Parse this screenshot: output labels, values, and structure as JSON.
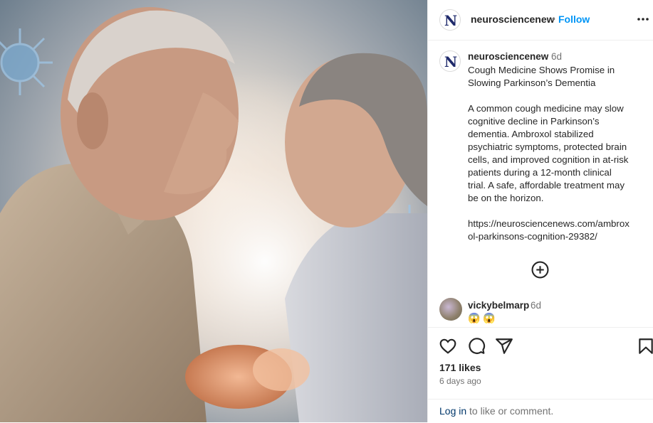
{
  "post": {
    "author": "neurosciencenew",
    "dot": "•",
    "follow_label": "Follow",
    "more_icon": "more-horizontal-icon",
    "caption": {
      "author": "neurosciencenew",
      "age": "6d",
      "title_line1": "Cough Medicine Shows Promise in",
      "title_line2": "Slowing Parkinson’s Dementia",
      "body_lines": [
        "A common cough medicine may slow",
        "cognitive decline in Parkinson’s",
        "dementia. Ambroxol stabilized",
        "psychiatric symptoms, protected brain",
        "cells, and improved cognition in at-risk",
        "patients during a 12-month clinical",
        "trial. A safe, affordable treatment may",
        "be on the horizon."
      ],
      "link_line1": "https://neurosciencenews.com/ambrox",
      "link_line2": "ol-parkinsons-cognition-29382/"
    },
    "load_more_icon": "plus-circle-icon",
    "comment": {
      "user": "vickybelmarp",
      "age": "6d",
      "text": "😱 😱"
    },
    "likes": "171 likes",
    "posted": "6 days ago",
    "login_link": "Log in",
    "login_suffix": " to like or comment."
  },
  "icons": [
    "heart-icon",
    "comment-icon",
    "share-icon",
    "bookmark-icon"
  ],
  "colors": {
    "accent": "#0095f6",
    "link": "#00376b",
    "muted": "#737373",
    "text": "#262626"
  }
}
